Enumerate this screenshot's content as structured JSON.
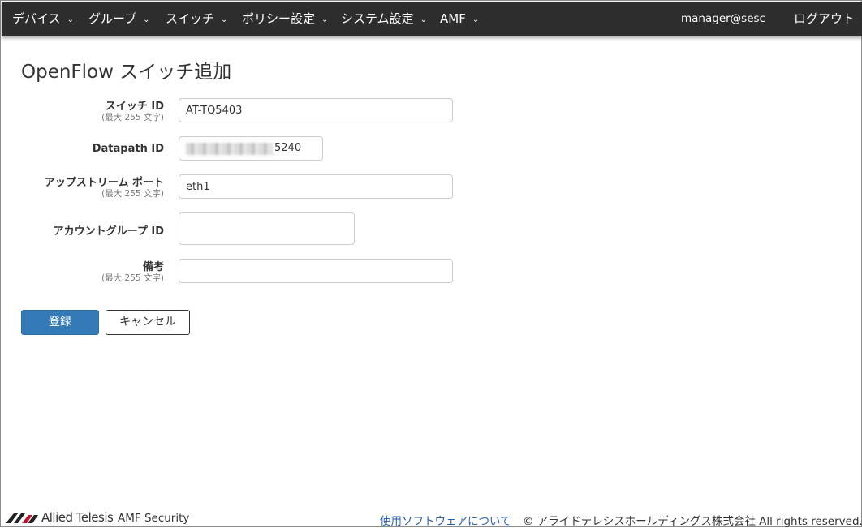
{
  "nav": {
    "items": [
      {
        "label": "デバイス"
      },
      {
        "label": "グループ"
      },
      {
        "label": "スイッチ"
      },
      {
        "label": "ポリシー設定"
      },
      {
        "label": "システム設定"
      },
      {
        "label": "AMF"
      }
    ],
    "caret": "⌄",
    "user": "manager@sesc",
    "logout": "ログアウト"
  },
  "page": {
    "title": "OpenFlow スイッチ追加"
  },
  "form": {
    "switch_id": {
      "label": "スイッチ ID",
      "hint": "(最大 255 文字)",
      "value": "AT-TQ5403"
    },
    "datapath_id": {
      "label": "Datapath ID",
      "value_visible_suffix": "5240"
    },
    "upstream_port": {
      "label": "アップストリーム ポート",
      "hint": "(最大 255 文字)",
      "value": "eth1"
    },
    "account_group_id": {
      "label": "アカウントグループ ID",
      "value": ""
    },
    "remarks": {
      "label": "備考",
      "hint": "(最大 255 文字)",
      "value": ""
    }
  },
  "buttons": {
    "register": "登録",
    "cancel": "キャンセル"
  },
  "footer": {
    "brand": "Allied Telesis",
    "product": "AMF Security",
    "link": "使用ソフトウェアについて",
    "copyright": "© アライドテレシスホールディングス株式会社 All rights reserved."
  },
  "colors": {
    "navbar_bg": "#2d2d2d",
    "primary": "#337ab7",
    "link": "#2a5db0"
  }
}
